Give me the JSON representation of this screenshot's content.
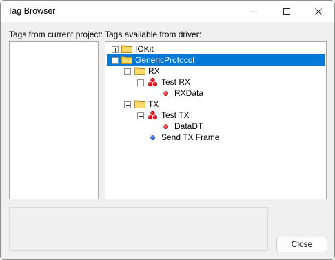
{
  "window": {
    "title": "Tag Browser"
  },
  "labels": {
    "left": "Tags from current project:",
    "right": "Tags available from driver:"
  },
  "tree": {
    "items": [
      {
        "label": "IOKit",
        "state": "collapsed",
        "icon": "folder-icon"
      },
      {
        "label": "GenericProtocol",
        "state": "expanded",
        "icon": "folder-icon",
        "selected": true
      },
      {
        "label": "RX",
        "state": "expanded",
        "icon": "folder-icon"
      },
      {
        "label": "Test RX",
        "state": "expanded",
        "icon": "tag-group-icon"
      },
      {
        "label": "RXData",
        "icon": "red-tag-icon"
      },
      {
        "label": "TX",
        "state": "expanded",
        "icon": "folder-icon"
      },
      {
        "label": "Test TX",
        "state": "expanded",
        "icon": "tag-group-icon"
      },
      {
        "label": "DataDT",
        "icon": "red-tag-icon"
      },
      {
        "label": "Send TX Frame",
        "icon": "blue-tag-icon"
      }
    ]
  },
  "buttons": {
    "close": "Close"
  },
  "colors": {
    "selection": "#0078d7",
    "folder": "#f3c947"
  }
}
